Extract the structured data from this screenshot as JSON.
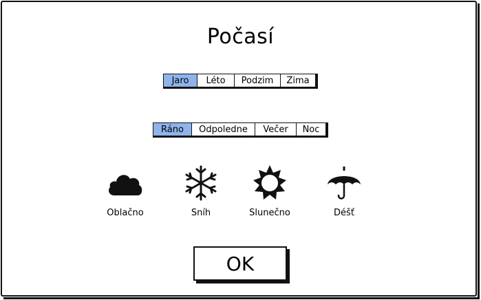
{
  "title": "Počasí",
  "seasons": {
    "items": [
      "Jaro",
      "Léto",
      "Podzim",
      "Zima"
    ],
    "selected": "Jaro"
  },
  "times": {
    "items": [
      "Ráno",
      "Odpoledne",
      "Večer",
      "Noc"
    ],
    "selected": "Ráno"
  },
  "weather": [
    {
      "label": "Oblačno",
      "icon": "cloud-icon"
    },
    {
      "label": "Sníh",
      "icon": "snowflake-icon"
    },
    {
      "label": "Slunečno",
      "icon": "sun-icon"
    },
    {
      "label": "Déšť",
      "icon": "umbrella-icon"
    }
  ],
  "ok_label": "OK",
  "colors": {
    "selected": "#8fb4ec",
    "ink": "#111111"
  }
}
